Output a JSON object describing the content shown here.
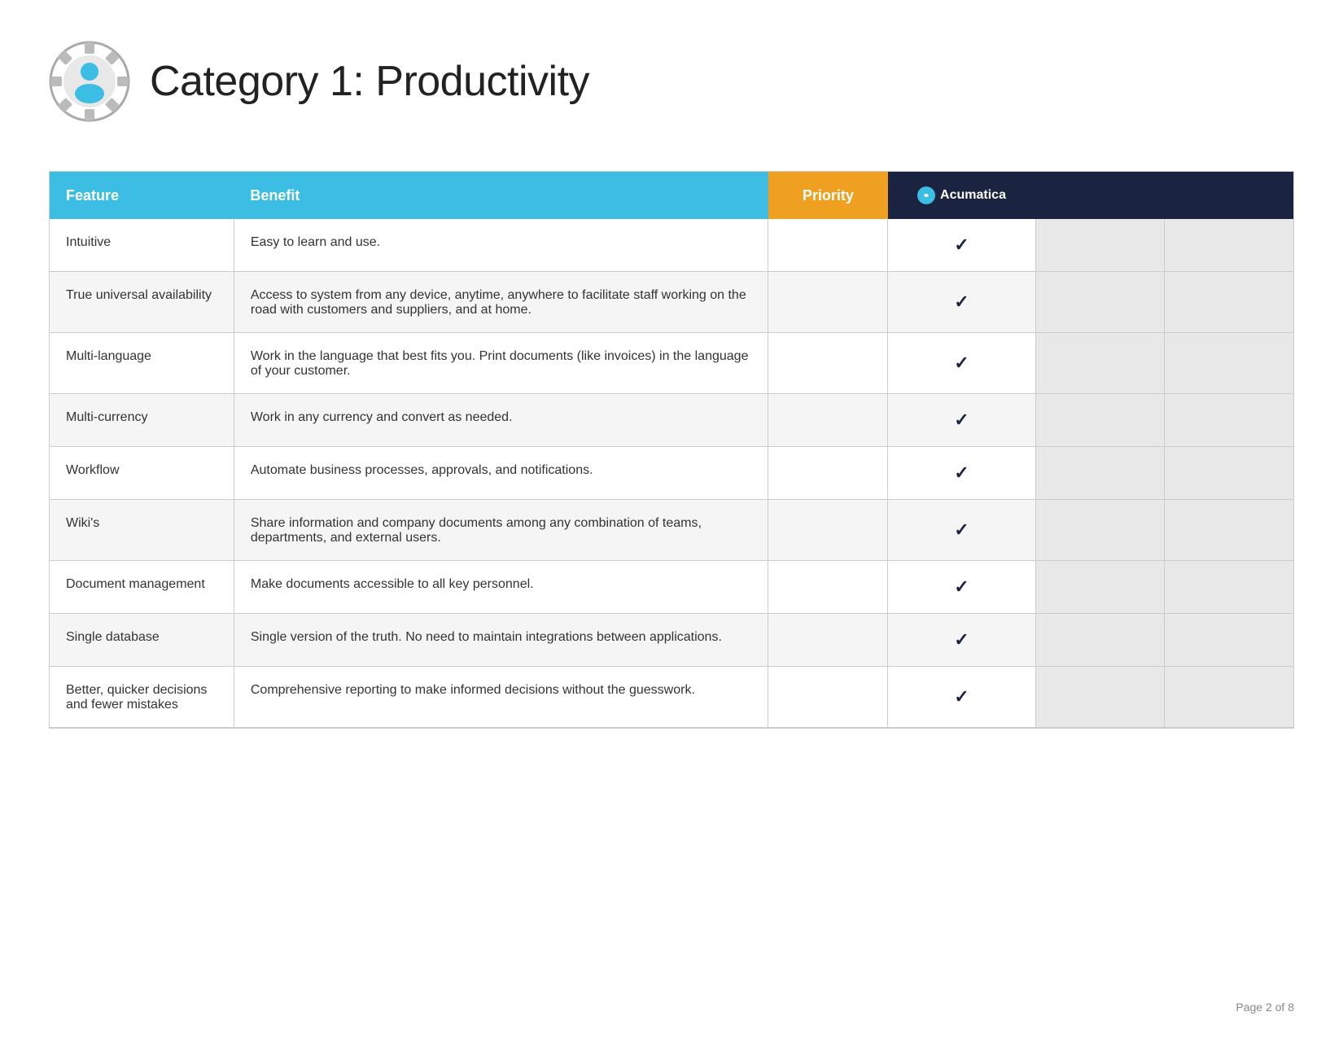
{
  "header": {
    "title": "Category 1: Productivity",
    "icon_label": "productivity-icon"
  },
  "table": {
    "columns": [
      {
        "id": "feature",
        "label": "Feature"
      },
      {
        "id": "benefit",
        "label": "Benefit"
      },
      {
        "id": "priority",
        "label": "Priority"
      },
      {
        "id": "acumatica",
        "label": "Acumatica"
      },
      {
        "id": "col4",
        "label": ""
      },
      {
        "id": "col5",
        "label": ""
      }
    ],
    "rows": [
      {
        "feature": "Intuitive",
        "benefit": "Easy to learn and use.",
        "priority": "",
        "acumatica_check": true,
        "col4_check": false,
        "col5_check": false
      },
      {
        "feature": "True universal availability",
        "benefit": "Access to system from any device, anytime, anywhere to facilitate staff working on the road with customers and suppliers, and at home.",
        "priority": "",
        "acumatica_check": true,
        "col4_check": false,
        "col5_check": false
      },
      {
        "feature": "Multi-language",
        "benefit": "Work in the language that best fits you. Print documents (like invoices) in the language of your customer.",
        "priority": "",
        "acumatica_check": true,
        "col4_check": false,
        "col5_check": false
      },
      {
        "feature": "Multi-currency",
        "benefit": "Work in any currency and convert as needed.",
        "priority": "",
        "acumatica_check": true,
        "col4_check": false,
        "col5_check": false
      },
      {
        "feature": "Workflow",
        "benefit": "Automate business processes, approvals, and notifications.",
        "priority": "",
        "acumatica_check": true,
        "col4_check": false,
        "col5_check": false
      },
      {
        "feature": "Wiki's",
        "benefit": "Share information and company documents among any combination of teams, departments, and external users.",
        "priority": "",
        "acumatica_check": true,
        "col4_check": false,
        "col5_check": false
      },
      {
        "feature": "Document management",
        "benefit": "Make documents accessible to all key personnel.",
        "priority": "",
        "acumatica_check": true,
        "col4_check": false,
        "col5_check": false
      },
      {
        "feature": "Single database",
        "benefit": "Single version of the truth. No need to maintain integrations between applications.",
        "priority": "",
        "acumatica_check": true,
        "col4_check": false,
        "col5_check": false
      },
      {
        "feature": "Better, quicker decisions and fewer mistakes",
        "benefit": "Comprehensive reporting to make informed decisions without the guesswork.",
        "priority": "",
        "acumatica_check": true,
        "col4_check": false,
        "col5_check": false
      }
    ]
  },
  "footer": {
    "page_number": "Page 2 of 8"
  }
}
